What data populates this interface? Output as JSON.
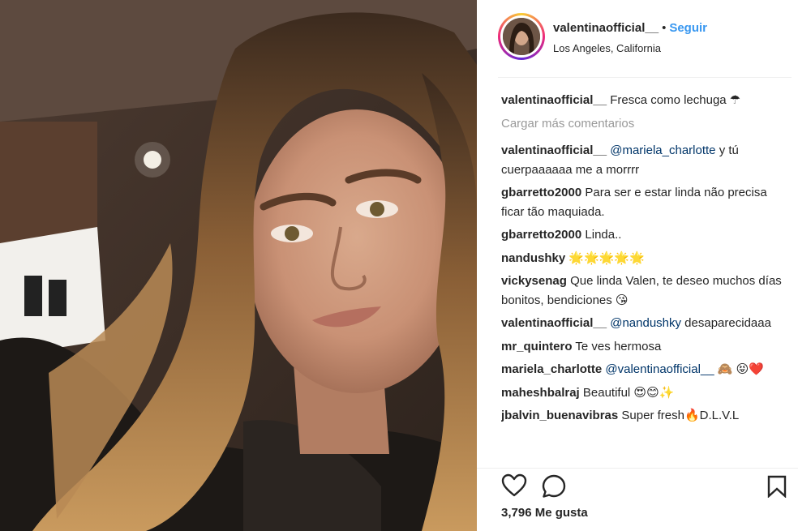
{
  "post": {
    "username": "valentinaofficial__",
    "separator": "•",
    "follow_label": "Seguir",
    "location": "Los Angeles, California"
  },
  "caption": {
    "user": "valentinaofficial__",
    "text": "Fresca como lechuga ☂"
  },
  "load_more": "Cargar más comentarios",
  "comments": [
    {
      "user": "valentinaofficial__",
      "mention": "@mariela_charlotte",
      "text": " y tú cuerpaaaaaa me a morrrr"
    },
    {
      "user": "gbarretto2000",
      "mention": "",
      "text": "Para ser e estar linda não precisa ficar tão maquiada."
    },
    {
      "user": "gbarretto2000",
      "mention": "",
      "text": "Linda.."
    },
    {
      "user": "nandushky",
      "mention": "",
      "text": "🌟🌟🌟🌟🌟"
    },
    {
      "user": "vickysenag",
      "mention": "",
      "text": "Que linda Valen, te deseo muchos días bonitos, bendiciones 😘"
    },
    {
      "user": "valentinaofficial__",
      "mention": "@nandushky",
      "text": " desaparecidaaa"
    },
    {
      "user": "mr_quintero",
      "mention": "",
      "text": "Te ves hermosa"
    },
    {
      "user": "mariela_charlotte",
      "mention": "@valentinaofficial__",
      "text": " 🙈 😝❤️"
    },
    {
      "user": "maheshbalraj",
      "mention": "",
      "text": "Beautiful 😍😊✨"
    },
    {
      "user": "jbalvin_buenavibras",
      "mention": "",
      "text": "Super fresh🔥D.L.V.L"
    }
  ],
  "actions": {
    "like_icon": "heart-icon",
    "comment_icon": "comment-icon",
    "save_icon": "bookmark-icon"
  },
  "likes_text": "3,796 Me gusta"
}
